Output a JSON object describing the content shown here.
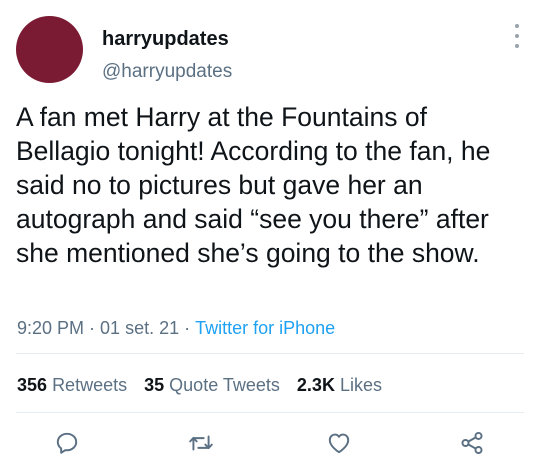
{
  "author": {
    "display_name": "harryupdates",
    "handle": "@harryupdates",
    "avatar_color": "#7b1a33"
  },
  "tweet": {
    "text": "A fan met Harry at the Fountains of Bellagio tonight! According to the fan, he said no to pictures but gave her an autograph and said “see you there” after she mentioned she’s going to the show.",
    "time": "9:20 PM",
    "date": "01 set. 21",
    "separator": "·",
    "source": "Twitter for iPhone"
  },
  "stats": {
    "retweets_count": "356",
    "retweets_label": "Retweets",
    "quote_count": "35",
    "quote_label": "Quote Tweets",
    "likes_count": "2.3K",
    "likes_label": "Likes"
  },
  "actions": [
    "reply-icon",
    "retweet-icon",
    "like-icon",
    "share-icon"
  ],
  "colors": {
    "link": "#1da1f2",
    "secondary_text": "#5b7083",
    "icon": "#5b7083"
  }
}
